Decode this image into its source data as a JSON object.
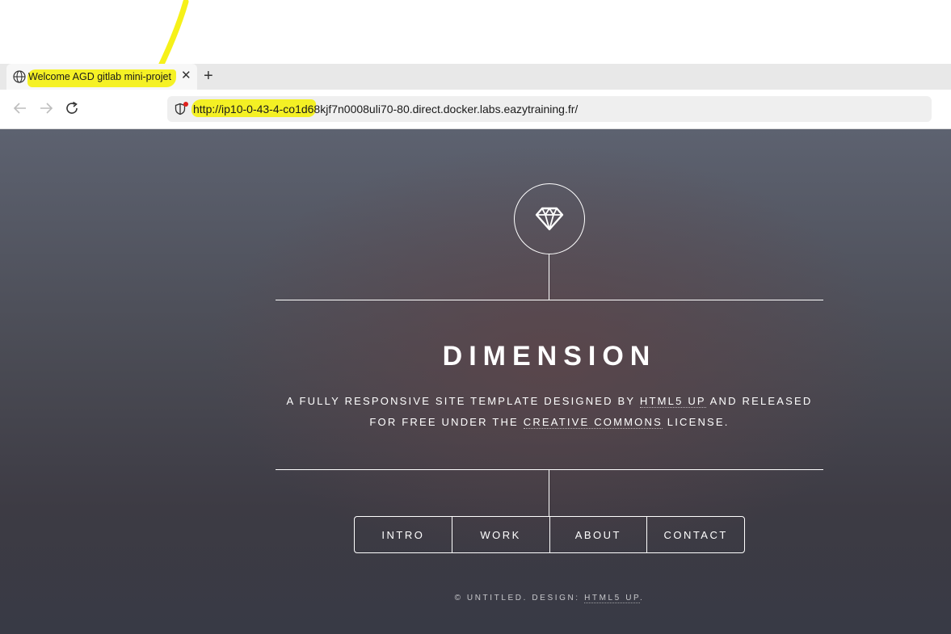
{
  "browser": {
    "tab": {
      "title": "Welcome AGD gitlab mini-projet",
      "close_glyph": "✕",
      "icon": "globe-icon"
    },
    "new_tab_glyph": "+",
    "nav_icons": [
      "back-arrow-icon",
      "forward-arrow-icon",
      "reload-icon"
    ],
    "url": "http://ip10-0-43-4-co1d68kjf7n0008uli70-80.direct.docker.labs.eazytraining.fr/",
    "highlight_color": "#f5f000",
    "security_dot_color": "#e0201c"
  },
  "site": {
    "logo_icon": "diamond-icon",
    "title": "DIMENSION",
    "description": {
      "part1": "A FULLY RESPONSIVE SITE TEMPLATE DESIGNED BY ",
      "link1": "HTML5 UP",
      "part2": " AND RELEASED",
      "part3": "FOR FREE UNDER THE ",
      "link2": "CREATIVE COMMONS",
      "part4": " LICENSE."
    },
    "nav": [
      "INTRO",
      "WORK",
      "ABOUT",
      "CONTACT"
    ],
    "footer": {
      "text": "© UNTITLED. DESIGN: ",
      "link": "HTML5 UP",
      "suffix": "."
    }
  }
}
